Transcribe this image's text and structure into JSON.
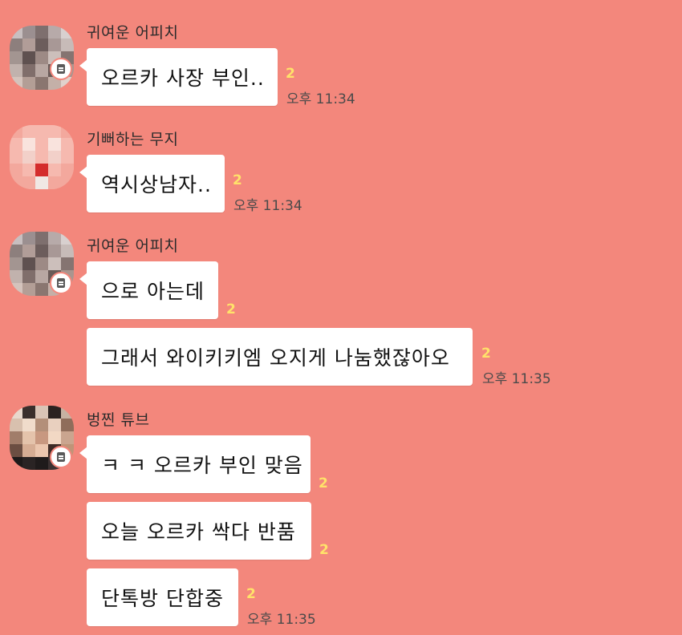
{
  "messages": [
    {
      "sender": "귀여운 어피치",
      "text": "오르카 사장 부인..",
      "unread": "2",
      "time": "오후 11:34"
    },
    {
      "sender": "기뻐하는 무지",
      "text": "역시상남자..",
      "unread": "2",
      "time": "오후 11:34"
    },
    {
      "sender": "귀여운 어피치",
      "text": "으로 아는데",
      "unread": "2",
      "time": ""
    },
    {
      "sender": "",
      "text": "그래서 와이키키엠 오지게 나눔했잖아오",
      "unread": "2",
      "time": "오후 11:35"
    },
    {
      "sender": "벙찐 튜브",
      "text": "ㅋ ㅋ 오르카 부인 맞음",
      "unread": "2",
      "time": ""
    },
    {
      "sender": "",
      "text": "오늘 오르카 싹다 반품",
      "unread": "2",
      "time": ""
    },
    {
      "sender": "",
      "text": "단톡방 단합중",
      "unread": "2",
      "time": "오후 11:35"
    }
  ],
  "colors": {
    "background": "#f3877c",
    "bubble": "#ffffff",
    "unread_count": "#ffe26a"
  },
  "icons": {
    "profile_badge": "talk-profile-badge-icon"
  }
}
